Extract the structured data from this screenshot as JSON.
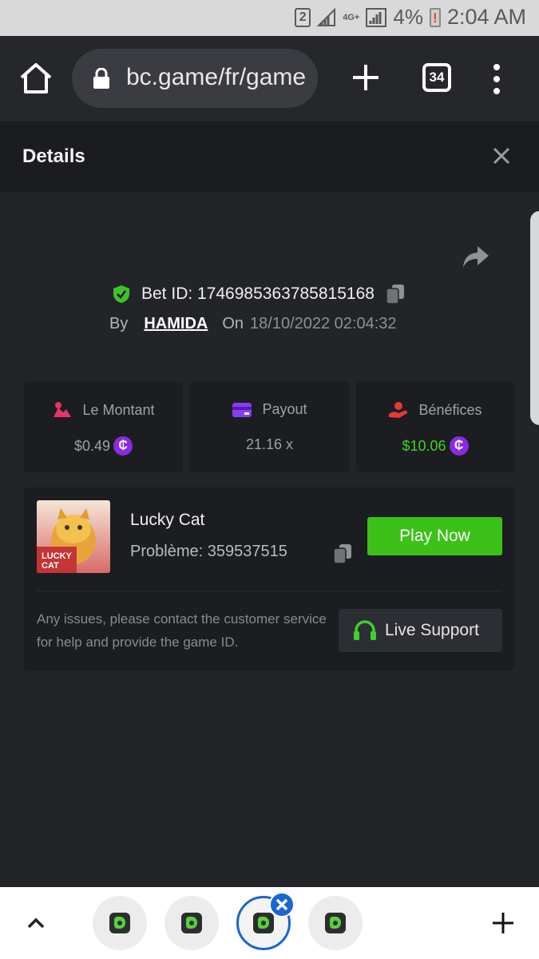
{
  "statusbar": {
    "sim": "2",
    "network": "4G+",
    "battery_pct": "4%",
    "time": "2:04 AM"
  },
  "browser": {
    "url": "bc.game/fr/game",
    "tab_count": "34",
    "icons": [
      "home-icon",
      "lock-icon",
      "plus-icon",
      "tab-switcher-icon",
      "overflow-menu-icon"
    ]
  },
  "details": {
    "title": "Details",
    "bet_id_label": "Bet ID: 1746985363785815168",
    "by_label": "By",
    "username": "HAMIDA",
    "on_label": "On",
    "date": "18/10/2022 02:04:32"
  },
  "stats": [
    {
      "label": "Le Montant",
      "value": "$0.49",
      "icon": "bet-amount-icon",
      "color": "#e8336b"
    },
    {
      "label": "Payout",
      "value": "21.16 x",
      "icon": "payout-card-icon",
      "color": "#8a3cf0"
    },
    {
      "label": "Bénéfices",
      "value": "$10.06",
      "icon": "profit-icon",
      "color": "#e33a3a"
    }
  ],
  "game": {
    "name": "Lucky Cat",
    "problem_label": "Problème: 359537515",
    "thumb_text": "LUCKY CAT",
    "play_label": "Play Now",
    "issues_text": "Any issues, please contact the customer service for help and provide the game ID.",
    "support_label": "Live Support"
  },
  "bottom": {
    "tabs": 4,
    "active_tab": 2
  },
  "colors": {
    "accent_green": "#3bc117",
    "coin_purple": "#8a2be2",
    "tab_blue": "#1a66d2"
  }
}
